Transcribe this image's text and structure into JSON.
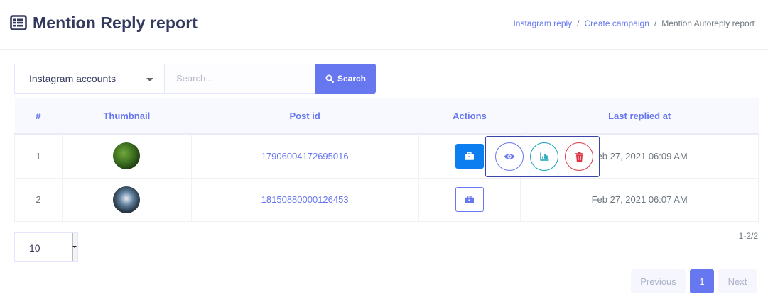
{
  "header": {
    "title": "Mention Reply report",
    "breadcrumb": [
      "Instagram reply",
      "Create campaign",
      "Mention Autoreply report"
    ]
  },
  "filters": {
    "account_select": "Instagram accounts",
    "search_placeholder": "Search...",
    "search_button": "Search"
  },
  "table": {
    "columns": [
      "#",
      "Thumbnail",
      "Post id",
      "Actions",
      "Last replied at"
    ],
    "rows": [
      {
        "index": "1",
        "post_id": "17906004172695016",
        "last_replied": "Feb 27, 2021 06:09 AM"
      },
      {
        "index": "2",
        "post_id": "18150880000126453",
        "last_replied": "Feb 27, 2021 06:07 AM"
      }
    ]
  },
  "popover": {
    "actions": [
      "view-icon",
      "chart-icon",
      "delete-icon"
    ]
  },
  "pagination": {
    "per_page": "10",
    "range": "1-2/2",
    "previous": "Previous",
    "current": "1",
    "next": "Next"
  },
  "colors": {
    "primary": "#6777ef",
    "solid_button": "#0d7ef0",
    "chart": "#17a2b8",
    "danger": "#dc3545"
  }
}
